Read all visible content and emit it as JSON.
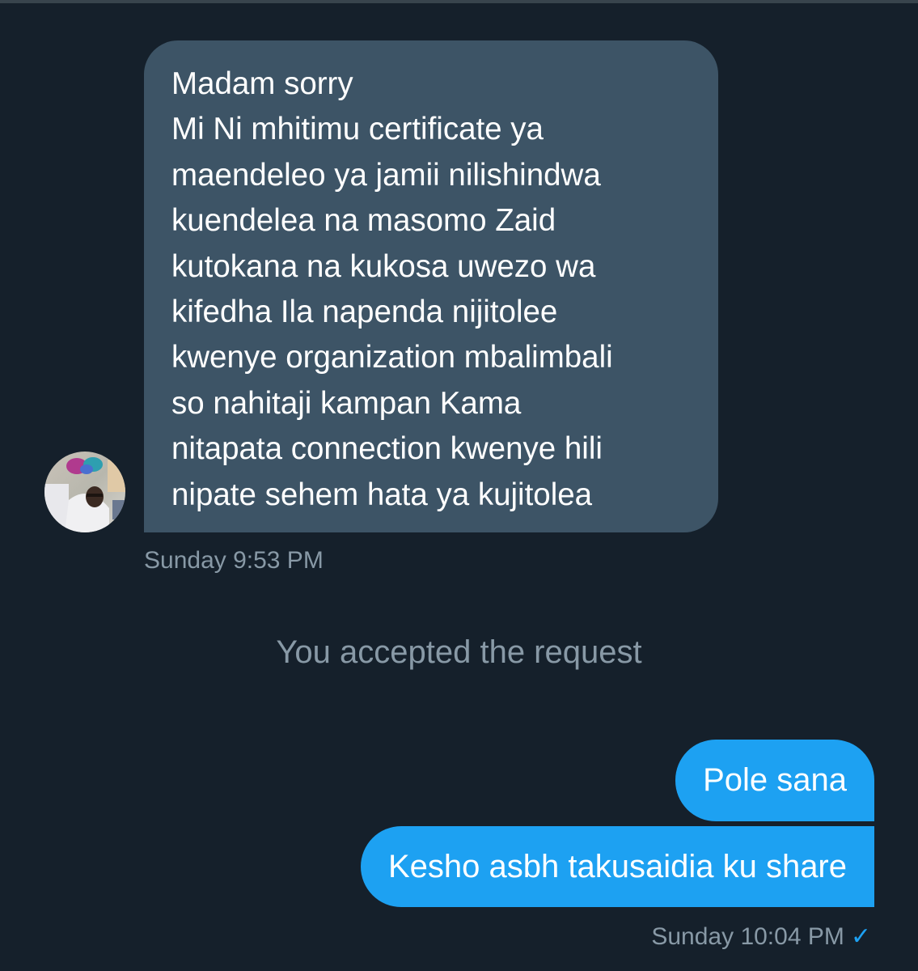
{
  "conversation": {
    "incoming_message": {
      "lines": [
        "Madam sorry",
        "Mi Ni mhitimu certificate ya",
        "maendeleo ya jamii nilishindwa",
        "kuendelea na masomo Zaid",
        "kutokana na kukosa uwezo wa",
        "kifedha Ila napenda nijitolee",
        "kwenye organization mbalimbali",
        "so nahitaji kampan Kama",
        "nitapata connection kwenye hili",
        "nipate sehem hata ya kujitolea"
      ],
      "timestamp": "Sunday 9:53 PM",
      "avatar_icon": "user-avatar"
    },
    "system_note": "You accepted the request",
    "outgoing_messages": [
      "Pole sana",
      "Kesho asbh takusaidia ku share"
    ],
    "outgoing_timestamp": "Sunday 10:04 PM",
    "read_receipt_icon": "checkmark-icon",
    "colors": {
      "background": "#15202b",
      "incoming_bubble": "#3d5466",
      "outgoing_bubble": "#1da1f2",
      "muted_text": "#8899a6"
    }
  }
}
